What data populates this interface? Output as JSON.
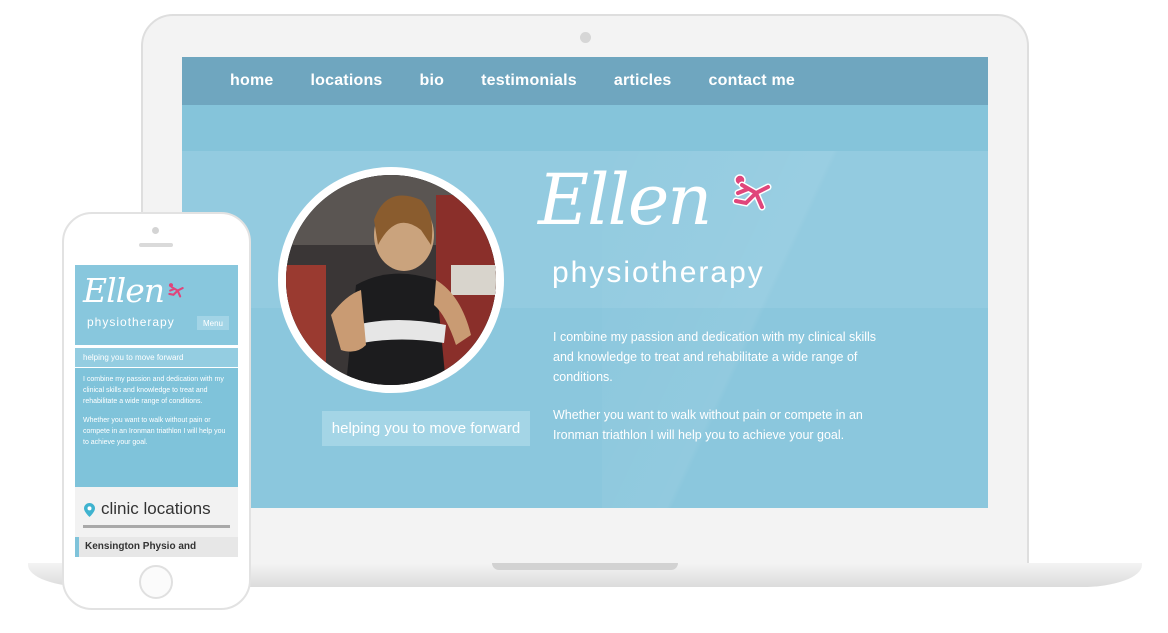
{
  "nav": {
    "items": [
      "home",
      "locations",
      "bio",
      "testimonials",
      "articles",
      "contact me"
    ]
  },
  "brand": {
    "name": "Ellen",
    "subtitle": "physiotherapy"
  },
  "hero": {
    "tagline": "helping you to move forward",
    "paragraph_1": "I combine my passion and dedication with my clinical skills and knowledge to treat and rehabilitate a wide range of conditions.",
    "paragraph_2": "Whether you want to walk without pain or compete in an Ironman triathlon I will help you to achieve your goal."
  },
  "mobile": {
    "menu_label": "Menu",
    "tagline": "helping you to move forward",
    "paragraph_1": "I combine my passion and dedication with my clinical skills and knowledge to treat and rehabilitate a wide range of conditions.",
    "paragraph_2": "Whether you want to walk without pain or compete in an Ironman triathlon I will help you to achieve your goal.",
    "clinic_heading": "clinic locations",
    "clinic_first_item": "Kensington Physio and"
  },
  "colors": {
    "screen_bg": "#86c5dc",
    "nav_bg": "#6fa6bf",
    "accent_pink": "#e0457b",
    "text_white": "#ffffff"
  },
  "icons": {
    "runner": "running-figure-icon",
    "pin": "location-pin-icon"
  }
}
